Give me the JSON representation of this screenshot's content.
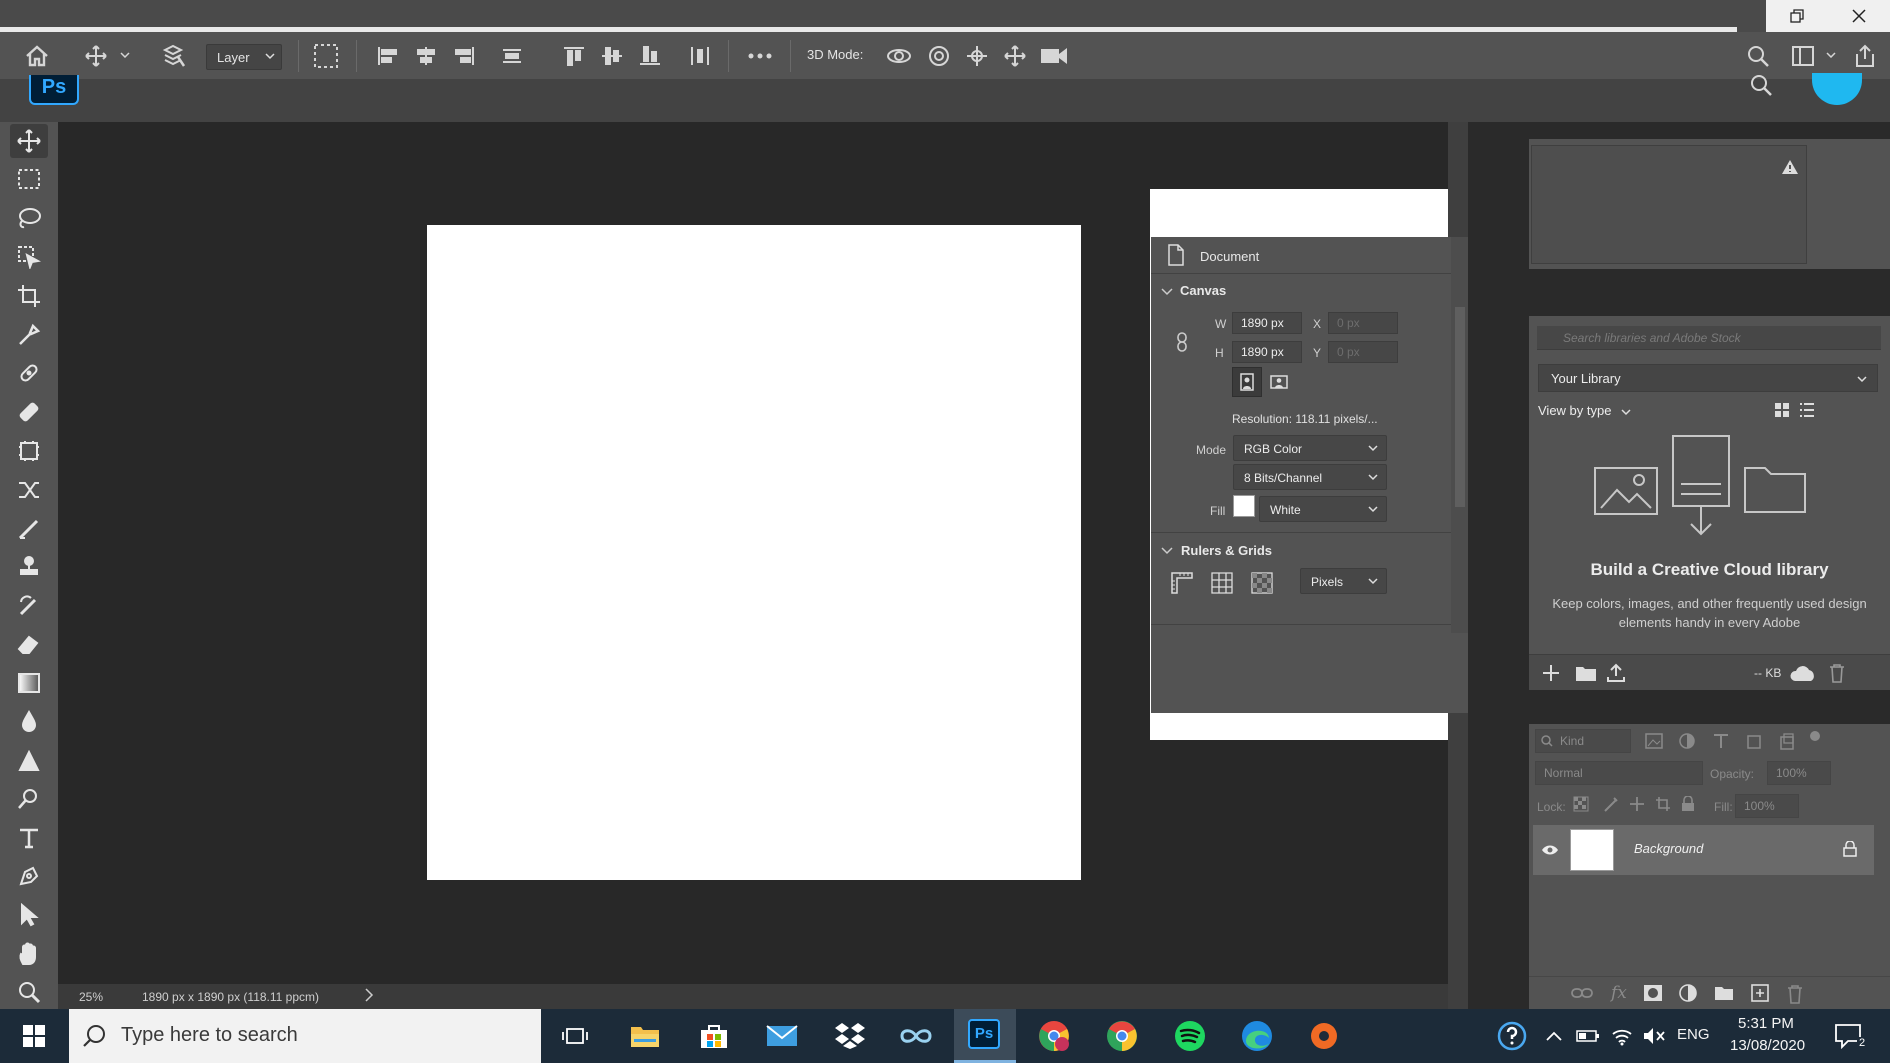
{
  "options_bar": {
    "layer_select": "Layer",
    "mode_3d_label": "3D Mode:"
  },
  "canvas": {
    "background_color": "#ffffff"
  },
  "status_bar": {
    "zoom": "25%",
    "doc_info": "1890 px x 1890 px (118.11 ppcm)"
  },
  "properties": {
    "section_document": "Document",
    "section_canvas": "Canvas",
    "w_label": "W",
    "w_value": "1890 px",
    "h_label": "H",
    "h_value": "1890 px",
    "x_label": "X",
    "x_value": "0 px",
    "y_label": "Y",
    "y_value": "0 px",
    "resolution": "Resolution:  118.11  pixels/...",
    "mode_label": "Mode",
    "mode_value": "RGB Color",
    "depth_value": "8 Bits/Channel",
    "fill_label": "Fill",
    "fill_value": "White",
    "section_rulers": "Rulers & Grids",
    "units_value": "Pixels"
  },
  "libraries": {
    "search_placeholder": "Search libraries and Adobe Stock",
    "library_select": "Your Library",
    "view_by": "View by type",
    "title": "Build a Creative Cloud library",
    "description": "Keep colors, images, and other frequently used design elements handy in every Adobe",
    "size": "-- KB"
  },
  "layers": {
    "kind_placeholder": "Kind",
    "blend_mode": "Normal",
    "opacity_label": "Opacity:",
    "opacity_value": "100%",
    "lock_label": "Lock:",
    "fill_label": "Fill:",
    "fill_value": "100%",
    "background_layer": "Background"
  },
  "taskbar": {
    "search_placeholder": "Type here to search",
    "language": "ENG",
    "time": "5:31 PM",
    "date": "13/08/2020",
    "notification_count": "2"
  }
}
